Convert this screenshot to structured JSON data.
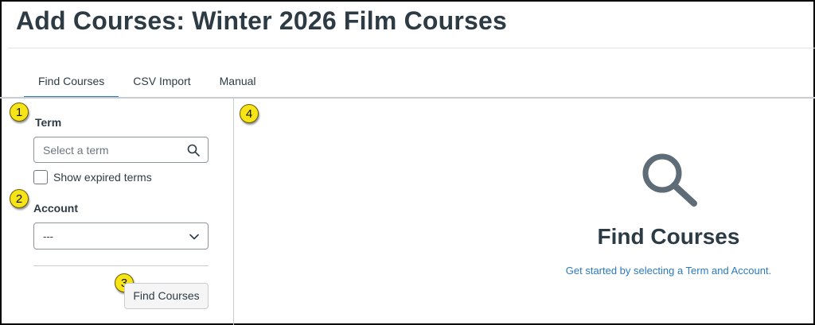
{
  "page": {
    "title": "Add Courses: Winter 2026 Film Courses"
  },
  "tabs": [
    {
      "label": "Find Courses",
      "active": true
    },
    {
      "label": "CSV Import",
      "active": false
    },
    {
      "label": "Manual",
      "active": false
    }
  ],
  "callouts": [
    "1",
    "2",
    "3",
    "4"
  ],
  "form": {
    "term_label": "Term",
    "term_placeholder": "Select a term",
    "show_expired_label": "Show expired terms",
    "show_expired_checked": false,
    "account_label": "Account",
    "account_value": "---",
    "find_button_label": "Find Courses"
  },
  "empty_state": {
    "icon": "search-icon",
    "title": "Find Courses",
    "subtitle": "Get started by selecting a Term and Account."
  },
  "colors": {
    "accent": "#2b7abc",
    "text": "#2d3b45",
    "callout": "#f7e417"
  }
}
